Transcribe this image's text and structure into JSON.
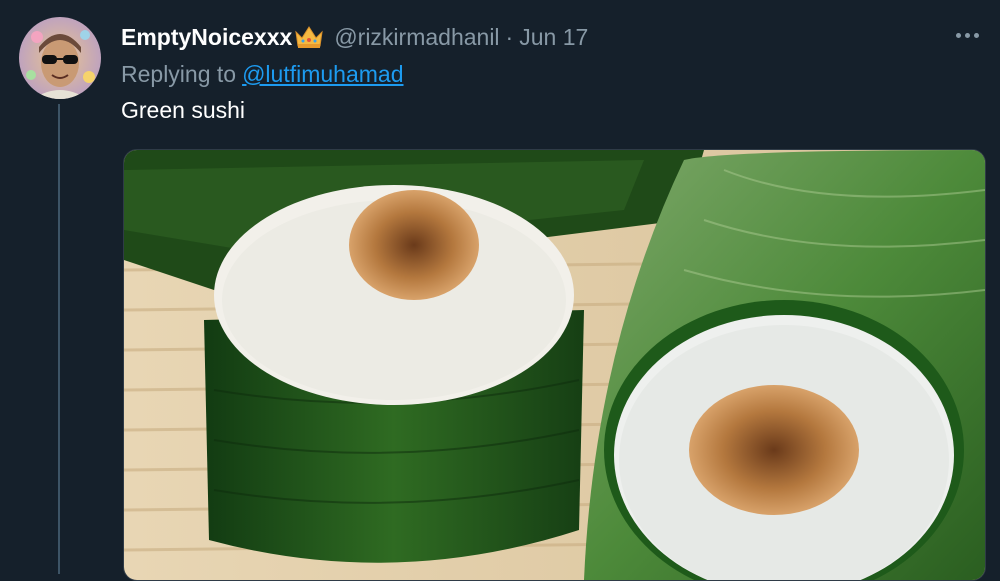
{
  "tweet": {
    "display_name": "EmptyNoicexxx",
    "handle": "@rizkirmadhanil",
    "separator": "·",
    "date": "Jun 17",
    "replying_prefix": "Replying to",
    "replying_to": "@lutfimuhamad",
    "text": "Green sushi"
  },
  "icons": {
    "badge": "crown-icon",
    "more": "more-options-icon"
  },
  "colors": {
    "background": "#15202b",
    "text_primary": "#ffffff",
    "text_secondary": "#8899a6",
    "link": "#1d9bf0"
  }
}
